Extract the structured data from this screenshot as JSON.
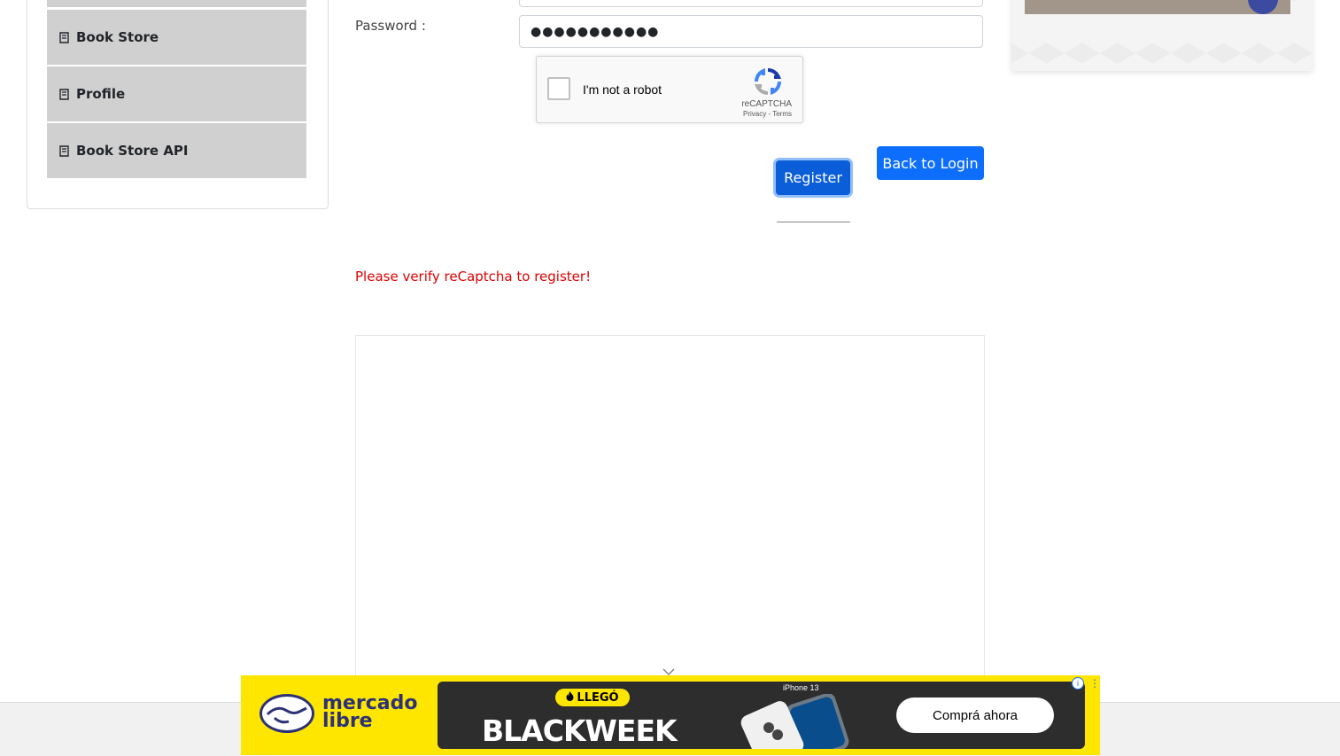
{
  "sidebar": {
    "items": [
      {
        "label": "Book Store",
        "icon": "book-icon"
      },
      {
        "label": "Profile",
        "icon": "book-icon"
      },
      {
        "label": "Book Store API",
        "icon": "book-icon"
      }
    ]
  },
  "form": {
    "password_label": "Password :",
    "password_value": "●●●●●●●●●●●",
    "recaptcha": {
      "text": "I'm not a robot",
      "brand": "reCAPTCHA",
      "links": "Privacy - Terms"
    },
    "register_label": "Register",
    "back_label": "Back to Login",
    "error": "Please verify reCaptcha to register!"
  },
  "ad": {
    "brand_line1": "mercado",
    "brand_line2": "libre",
    "pill": "LLEGÓ",
    "headline": "BLACKWEEK",
    "device": "iPhone 13",
    "cta": "Comprá ahora",
    "info": "i",
    "menu": "⋮"
  },
  "colors": {
    "primary": "#0d6efd",
    "error": "#e00000",
    "sidebar_item_bg": "#d0d0d0",
    "ad_yellow": "#ffe600",
    "ad_navy": "#2d3277"
  }
}
